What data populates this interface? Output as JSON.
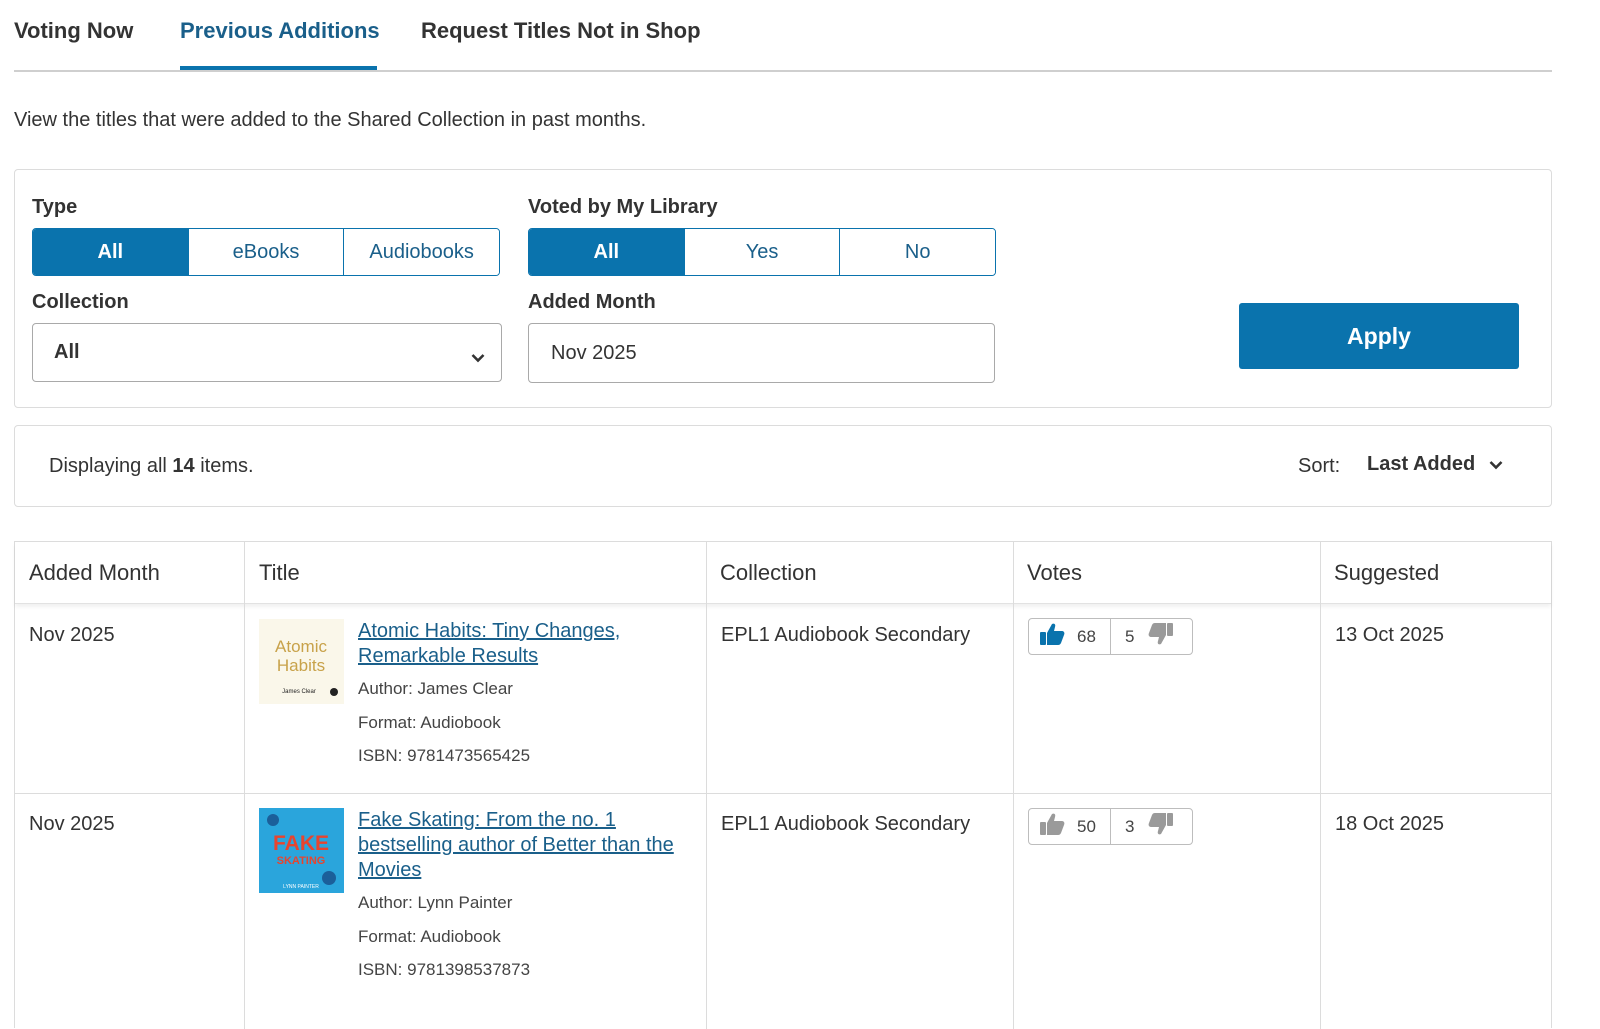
{
  "tabs": [
    {
      "label": "Voting Now"
    },
    {
      "label": "Previous Additions"
    },
    {
      "label": "Request Titles Not in Shop"
    }
  ],
  "intro": "View the titles that were added to the Shared Collection in past months.",
  "filters": {
    "type_label": "Type",
    "type_options": [
      "All",
      "eBooks",
      "Audiobooks"
    ],
    "voted_label": "Voted by My Library",
    "voted_options": [
      "All",
      "Yes",
      "No"
    ],
    "collection_label": "Collection",
    "collection_value": "All",
    "month_label": "Added Month",
    "month_value": "Nov 2025",
    "apply_label": "Apply"
  },
  "results": {
    "prefix": "Displaying all",
    "count": "14",
    "suffix": "items.",
    "sort_label": "Sort:",
    "sort_value": "Last Added"
  },
  "table": {
    "headers": [
      "Added Month",
      "Title",
      "Collection",
      "Votes",
      "Suggested"
    ],
    "rows": [
      {
        "month": "Nov 2025",
        "cover_text": "Atomic Habits",
        "cover_author": "James Clear",
        "title": "Atomic Habits: Tiny Changes, Remarkable Results",
        "author": "Author: James Clear",
        "format": "Format: Audiobook",
        "isbn": "ISBN: 9781473565425",
        "collection": "EPL1 Audiobook Secondary",
        "up": "68",
        "down": "5",
        "suggested": "13 Oct 2025"
      },
      {
        "month": "Nov 2025",
        "cover_text": "FAKE SKATING",
        "cover_author": "LYNN PAINTER",
        "title": "Fake Skating: From the no. 1 bestselling author of Better than the Movies",
        "author": "Author: Lynn Painter",
        "format": "Format: Audiobook",
        "isbn": "ISBN: 9781398537873",
        "collection": "EPL1 Audiobook Secondary",
        "up": "50",
        "down": "3",
        "suggested": "18 Oct 2025"
      }
    ]
  },
  "colors": {
    "accent": "#0a73ad",
    "link": "#1a5f8a",
    "vote_up_active": "#0a73ad",
    "vote_inactive": "#9a9a9a"
  }
}
